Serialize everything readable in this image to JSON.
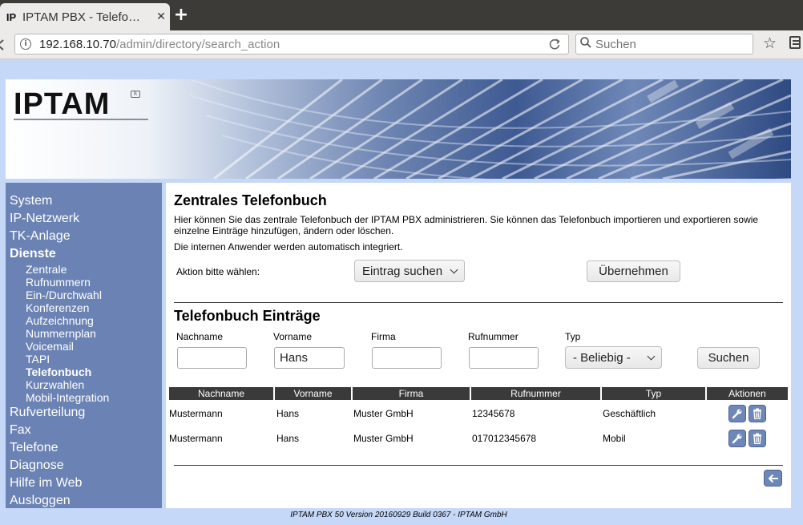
{
  "browser": {
    "tab_title": "IPTAM PBX - Telefo…",
    "tab_favicon": "IP",
    "close_symbol": "✕",
    "newtab_symbol": "+",
    "url_host": "192.168.10.70",
    "url_path": "/admin/directory/search_action",
    "search_placeholder": "Suchen"
  },
  "logo": {
    "text": "IPTAM"
  },
  "sidebar": {
    "items": [
      {
        "label": "System"
      },
      {
        "label": "IP-Netzwerk"
      },
      {
        "label": "TK-Anlage"
      },
      {
        "label": "Dienste",
        "active": true
      }
    ],
    "sub_items": [
      {
        "label": "Zentrale"
      },
      {
        "label": "Rufnummern"
      },
      {
        "label": "Ein-/Durchwahl"
      },
      {
        "label": "Konferenzen"
      },
      {
        "label": "Aufzeichnung"
      },
      {
        "label": "Nummernplan"
      },
      {
        "label": "Voicemail"
      },
      {
        "label": "TAPI"
      },
      {
        "label": "Telefonbuch",
        "active": true
      },
      {
        "label": "Kurzwahlen"
      },
      {
        "label": "Mobil-Integration"
      }
    ],
    "items_after": [
      {
        "label": "Rufverteilung"
      },
      {
        "label": "Fax"
      },
      {
        "label": "Telefone"
      },
      {
        "label": "Diagnose"
      },
      {
        "label": "Hilfe im Web"
      },
      {
        "label": "Ausloggen"
      }
    ]
  },
  "main": {
    "title": "Zentrales Telefonbuch",
    "description1": "Hier können Sie das zentrale Telefonbuch der IPTAM PBX administrieren. Sie können das Telefonbuch importieren und exportieren sowie einzelne Einträge hinzufügen, ändern oder löschen.",
    "description2": "Die internen Anwender werden automatisch integriert.",
    "action_label": "Aktion bitte wählen:",
    "action_selected": "Eintrag suchen",
    "apply_button": "Übernehmen",
    "entries_title": "Telefonbuch Einträge",
    "filters": {
      "nachname_label": "Nachname",
      "nachname_value": "",
      "vorname_label": "Vorname",
      "vorname_value": "Hans",
      "firma_label": "Firma",
      "firma_value": "",
      "rufnummer_label": "Rufnummer",
      "rufnummer_value": "",
      "typ_label": "Typ",
      "typ_selected": "- Beliebig -",
      "search_button": "Suchen"
    },
    "table": {
      "columns": [
        "Nachname",
        "Vorname",
        "Firma",
        "Rufnummer",
        "Typ",
        "Aktionen"
      ],
      "rows": [
        {
          "nachname": "Mustermann",
          "vorname": "Hans",
          "firma": "Muster GmbH",
          "rufnummer": "12345678",
          "typ": "Geschäftlich"
        },
        {
          "nachname": "Mustermann",
          "vorname": "Hans",
          "firma": "Muster GmbH",
          "rufnummer": "017012345678",
          "typ": "Mobil"
        }
      ]
    }
  },
  "footer": "IPTAM PBX 50 Version 20160929 Build 0367 - IPTAM GmbH",
  "colors": {
    "page_bg": "#c5d8f8",
    "sidebar_bg": "#6b83b4",
    "table_header_bg": "#3a3a3a",
    "icon_button_bg": "#6d87b8"
  }
}
